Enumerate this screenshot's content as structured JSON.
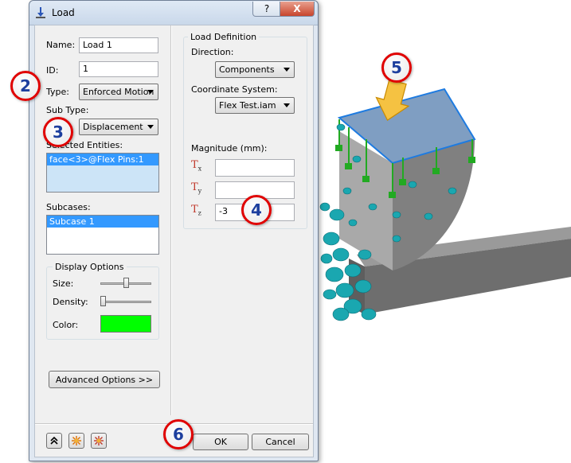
{
  "dialog": {
    "title": "Load",
    "help_label": "?",
    "close_label": "X",
    "name_label": "Name:",
    "name_value": "Load 1",
    "id_label": "ID:",
    "id_value": "1",
    "type_label": "Type:",
    "type_value": "Enforced Motion",
    "subtype_label": "Sub Type:",
    "subtype_value": "Displacement",
    "entities_label": "Selected Entities:",
    "entities_items": [
      "face<3>@Flex Pins:1"
    ],
    "subcases_label": "Subcases:",
    "subcases_items": [
      "Subcase 1"
    ],
    "display_options": {
      "title": "Display Options",
      "size_label": "Size:",
      "size_value": 0.5,
      "density_label": "Density:",
      "density_value": 0.0,
      "color_label": "Color:",
      "color_value": "#00ff00"
    },
    "advanced_button": "Advanced Options >>",
    "load_definition": {
      "title": "Load Definition",
      "direction_label": "Direction:",
      "direction_value": "Components",
      "coord_label": "Coordinate System:",
      "coord_value": "Flex Test.iam",
      "magnitude_label": "Magnitude (mm):",
      "tx_label": "T",
      "tx_sub": "x",
      "tx_value": "",
      "ty_label": "T",
      "ty_sub": "y",
      "ty_value": "",
      "tz_label": "T",
      "tz_sub": "z",
      "tz_value": "-3"
    },
    "ok_button": "OK",
    "cancel_button": "Cancel"
  },
  "callouts": [
    "2",
    "3",
    "4",
    "5",
    "6"
  ],
  "colors": {
    "selection": "#3399ff",
    "callout_ring": "#e00000",
    "callout_text": "#1d3f9e",
    "constraint_arrow": "#1aa7b0",
    "load_arrow": "#22aa22"
  }
}
